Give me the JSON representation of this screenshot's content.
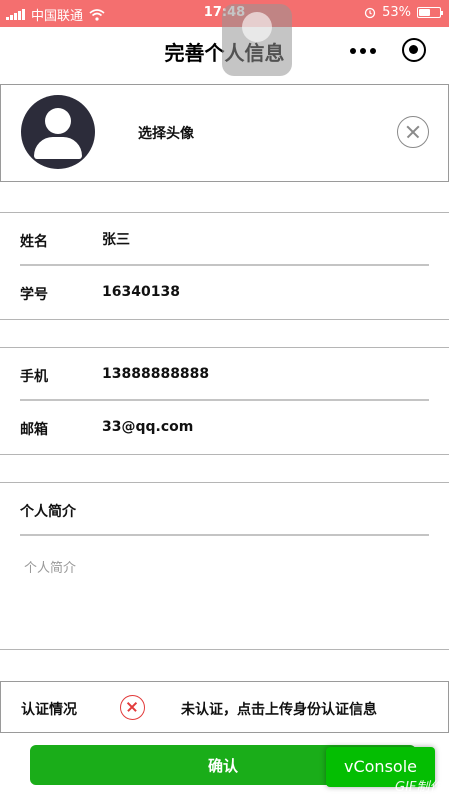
{
  "status_bar": {
    "carrier": "中国联通",
    "time": "17:48",
    "battery": "53%",
    "battery_level": 0.53
  },
  "nav": {
    "title": "完善个人信息"
  },
  "avatar": {
    "label": "选择头像"
  },
  "basic_info": [
    {
      "label": "姓名",
      "value": "张三"
    },
    {
      "label": "学号",
      "value": "16340138"
    }
  ],
  "contact_info": [
    {
      "label": "手机",
      "value": "13888888888"
    },
    {
      "label": "邮箱",
      "value": "33@qq.com"
    }
  ],
  "bio": {
    "title": "个人简介",
    "placeholder": "个人简介"
  },
  "verification": {
    "label": "认证情况",
    "status_text": "未认证，点击上传身份认证信息"
  },
  "buttons": {
    "confirm": "确认",
    "vconsole": "vConsole"
  },
  "watermark": "GIF制作",
  "colors": {
    "status_bar": "#f46f6f",
    "primary_green": "#1aad19",
    "error_red": "#e23b3b"
  }
}
